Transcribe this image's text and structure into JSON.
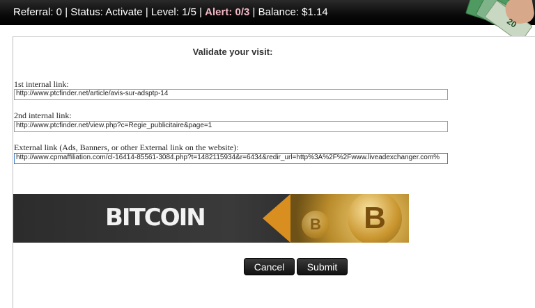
{
  "status_bar": {
    "referral": "Referral: 0",
    "status": "Status: Activate",
    "level": "Level: 1/5",
    "alert": "Alert: 0/3",
    "balance": "Balance: $1.14",
    "separator": " | ",
    "money_image_text": "20"
  },
  "form": {
    "title": "Validate your visit:",
    "fields": [
      {
        "label": "1st internal link:",
        "value": "http://www.ptcfinder.net/article/avis-sur-adsptp-14"
      },
      {
        "label": "2nd internal link:",
        "value": "http://www.ptcfinder.net/view.php?c=Regie_publicitaire&page=1"
      },
      {
        "label": "External link (Ads, Banners, or other External link on the website):",
        "value": "http://www.cpmaffiliation.com/cl-16414-85561-3084.php?t=1482115934&r=6434&redir_url=http%3A%2F%2Fwww.liveadexchanger.com%"
      }
    ]
  },
  "banner": {
    "text": "BITCOIN",
    "coin_symbol": "B"
  },
  "buttons": {
    "cancel": "Cancel",
    "submit": "Submit"
  }
}
